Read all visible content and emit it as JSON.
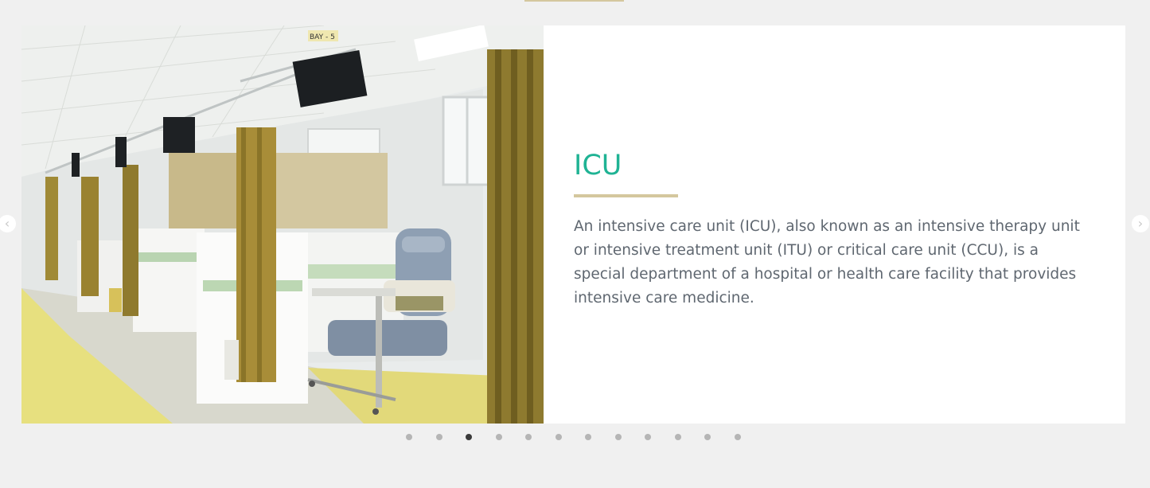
{
  "slide": {
    "title": "ICU",
    "description": "An intensive care unit (ICU), also known as an intensive therapy unit or intensive treatment unit (ITU) or critical care unit (CCU), is a special department of a hospital or health care facility that provides intensive care medicine.",
    "photo_sign_text": "BAY - 5"
  },
  "navigation": {
    "prev_icon": "chevron-left-icon",
    "next_icon": "chevron-right-icon",
    "prev_glyph": "‹",
    "next_glyph": "›"
  },
  "pagination": {
    "total": 12,
    "active_index": 2
  },
  "colors": {
    "page_background": "#f0f0f0",
    "title": "#1fb394",
    "accent": "#d4c79e",
    "body_text": "#5f6770",
    "dot": "#b5b5b5",
    "dot_active": "#3a3a3a"
  }
}
